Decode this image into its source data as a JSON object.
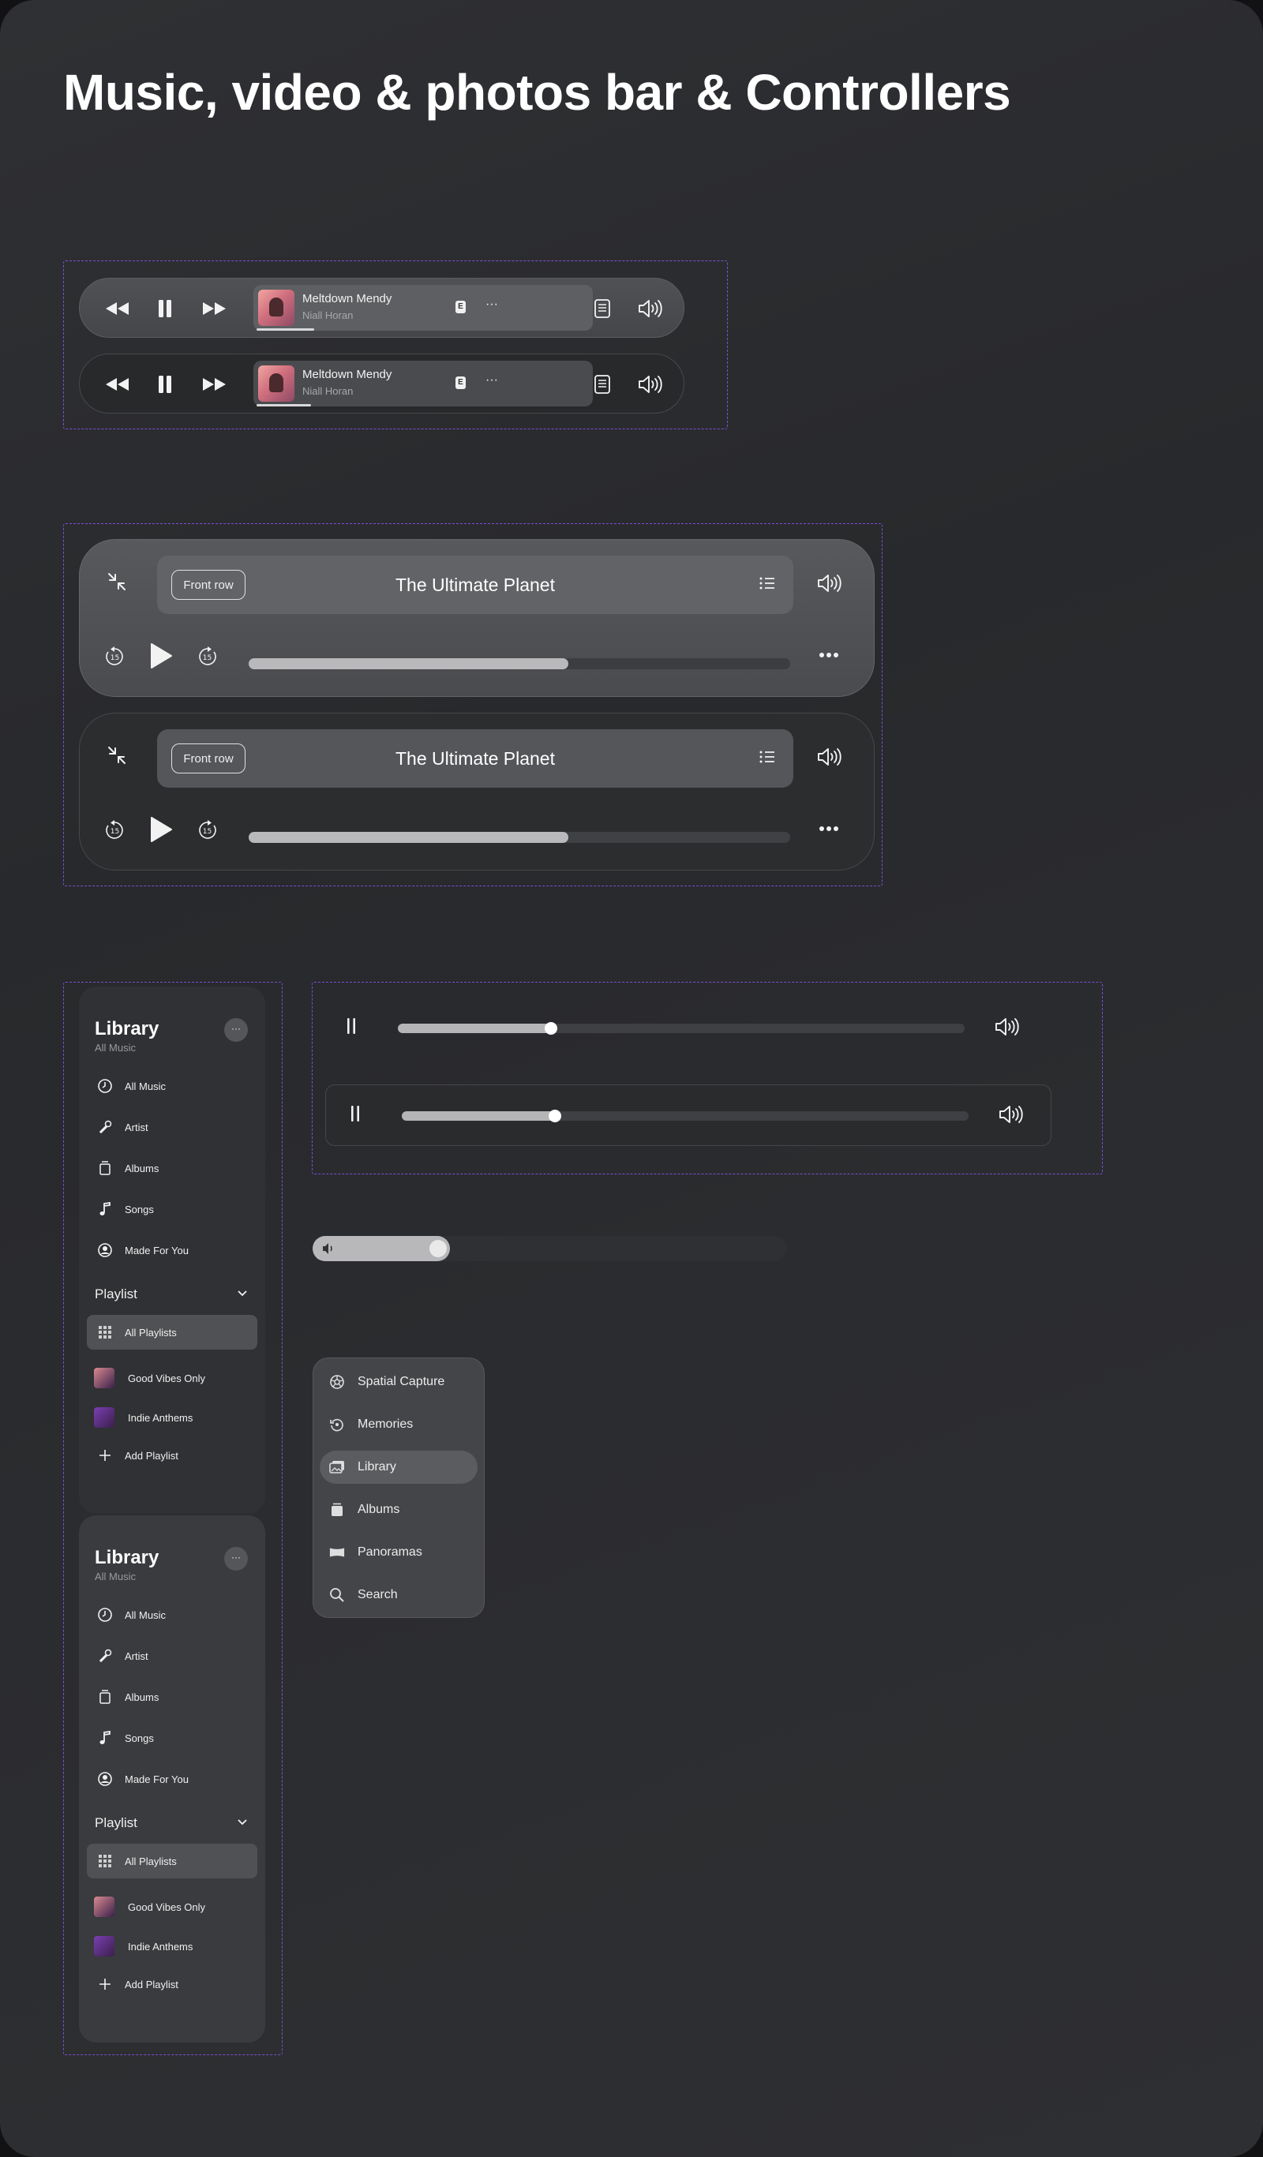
{
  "page": {
    "title": "Music, video & photos bar & Controllers"
  },
  "mini_players": [
    {
      "variant": "light",
      "song": "Meltdown Mendy",
      "artist": "Niall Horan",
      "progress": 0.17
    },
    {
      "variant": "dark",
      "song": "Meltdown Mendy",
      "artist": "Niall Horan",
      "progress": 0.16
    }
  ],
  "mini_badge": "E",
  "mini_icons": [
    "rewind-icon",
    "pause-icon",
    "fast-forward-icon",
    "lyrics-icon",
    "queue-icon",
    "volume-icon"
  ],
  "big_players": [
    {
      "variant": "light",
      "pill_label": "Front row",
      "title": "The Ultimate Planet",
      "skip_seconds": "15",
      "progress": 0.59
    },
    {
      "variant": "dark",
      "pill_label": "Front row",
      "title": "The Ultimate Planet",
      "skip_seconds": "15",
      "progress": 0.59
    }
  ],
  "library": {
    "title": "Library",
    "subtitle": "All Music",
    "more": "···",
    "items": [
      {
        "label": "All Music",
        "icon": "clock-icon"
      },
      {
        "label": "Artist",
        "icon": "microphone-icon"
      },
      {
        "label": "Albums",
        "icon": "album-icon"
      },
      {
        "label": "Songs",
        "icon": "music-note-icon"
      },
      {
        "label": "Made For You",
        "icon": "user-circle-icon"
      }
    ],
    "playlist_section": "Playlist",
    "playlists": [
      {
        "label": "All Playlists",
        "icon": "grid-icon",
        "selected": true
      },
      {
        "label": "Good Vibes Only",
        "icon": "playlist-thumb",
        "color": "#d88a8f"
      },
      {
        "label": "Indie Anthems",
        "icon": "playlist-thumb",
        "color": "#7a3fb3"
      },
      {
        "label": "Add Playlist",
        "icon": "plus-icon"
      }
    ]
  },
  "sliders": [
    {
      "boxed": false,
      "progress": 0.27
    },
    {
      "boxed": true,
      "progress": 0.27
    }
  ],
  "volume": {
    "level": 0.29
  },
  "photo_menu": {
    "items": [
      {
        "label": "Spatial Capture",
        "icon": "aperture-icon",
        "selected": false
      },
      {
        "label": "Memories",
        "icon": "memories-icon",
        "selected": false
      },
      {
        "label": "Library",
        "icon": "photo-library-icon",
        "selected": true
      },
      {
        "label": "Albums",
        "icon": "album-stack-icon",
        "selected": false
      },
      {
        "label": "Panoramas",
        "icon": "panorama-icon",
        "selected": false
      },
      {
        "label": "Search",
        "icon": "search-icon",
        "selected": false
      }
    ]
  }
}
